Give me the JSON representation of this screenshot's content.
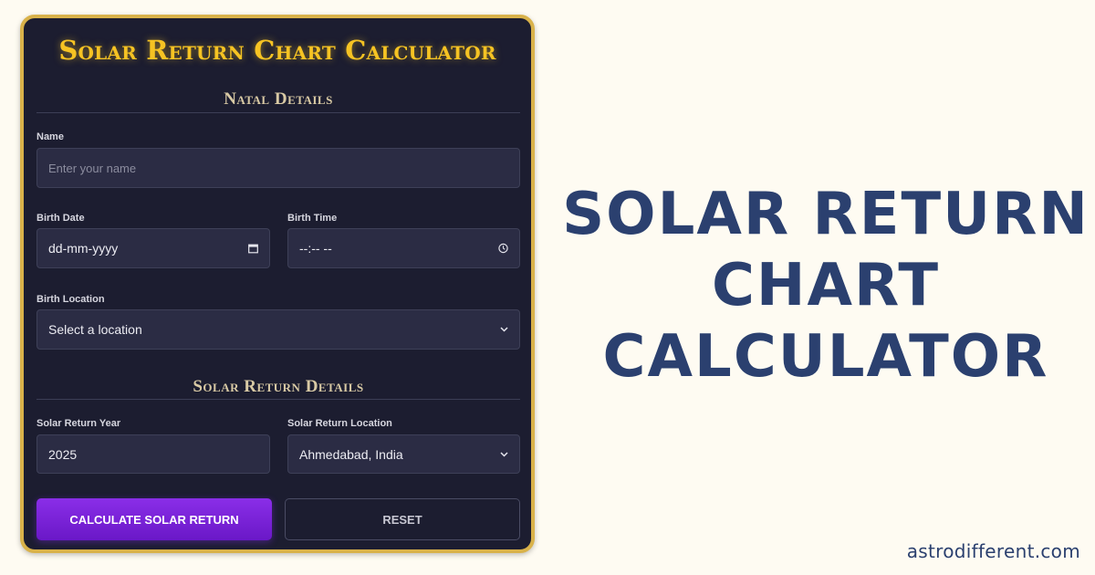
{
  "form": {
    "title": "Solar Return Chart Calculator",
    "natal_section_title": "Natal Details",
    "name_label": "Name",
    "name_placeholder": "Enter your name",
    "birth_date_label": "Birth Date",
    "birth_date_value": "dd-mm-yyyy",
    "birth_time_label": "Birth Time",
    "birth_time_value": "--:-- --",
    "birth_location_label": "Birth Location",
    "birth_location_value": "Select a location",
    "solar_section_title": "Solar Return Details",
    "sr_year_label": "Solar Return Year",
    "sr_year_value": "2025",
    "sr_location_label": "Solar Return Location",
    "sr_location_value": "Ahmedabad, India",
    "calculate_label": "CALCULATE SOLAR RETURN",
    "reset_label": "RESET"
  },
  "headline": {
    "line1": "SOLAR RETURN",
    "line2": "CHART",
    "line3": "CALCULATOR"
  },
  "site": "astrodifferent.com",
  "icons": {
    "calendar": "calendar-icon",
    "clock": "clock-icon",
    "chevron": "chevron-down-icon"
  },
  "colors": {
    "page_background": "#fefbf2",
    "card_background": "#1c1d30",
    "card_border": "#d9b24a",
    "title_gold": "#f6c323",
    "primary_button": "#7b22d9",
    "headline_navy": "#2b406f"
  }
}
